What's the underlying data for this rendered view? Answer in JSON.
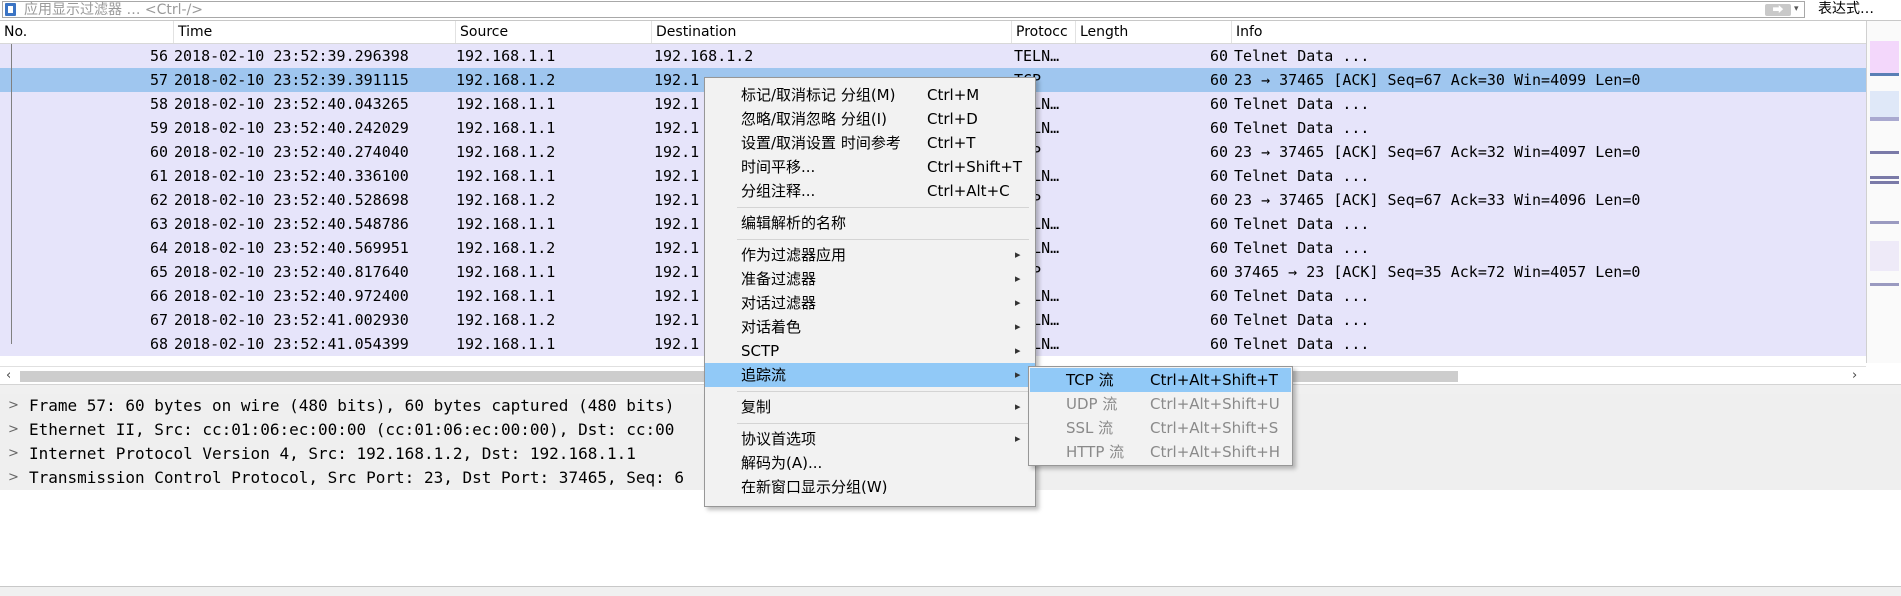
{
  "filter": {
    "placeholder": "应用显示过滤器 … <Ctrl-/>",
    "expression_label": "表达式…"
  },
  "columns": [
    "No.",
    "Time",
    "Source",
    "Destination",
    "Protocc",
    "Length",
    "Info"
  ],
  "packets": [
    {
      "no": "56",
      "time": "2018-02-10 23:52:39.296398",
      "src": "192.168.1.1",
      "dst": "192.168.1.2",
      "proto": "TELN…",
      "len": "60",
      "info": "Telnet Data ..."
    },
    {
      "no": "57",
      "time": "2018-02-10 23:52:39.391115",
      "src": "192.168.1.2",
      "dst": "192.1",
      "proto": "TCP",
      "len": "60",
      "info": "23 → 37465 [ACK] Seq=67 Ack=30 Win=4099 Len=0",
      "selected": true
    },
    {
      "no": "58",
      "time": "2018-02-10 23:52:40.043265",
      "src": "192.168.1.1",
      "dst": "192.1",
      "proto": "TELN…",
      "len": "60",
      "info": "Telnet Data ..."
    },
    {
      "no": "59",
      "time": "2018-02-10 23:52:40.242029",
      "src": "192.168.1.1",
      "dst": "192.1",
      "proto": "TELN…",
      "len": "60",
      "info": "Telnet Data ..."
    },
    {
      "no": "60",
      "time": "2018-02-10 23:52:40.274040",
      "src": "192.168.1.2",
      "dst": "192.1",
      "proto": "TCP",
      "len": "60",
      "info": "23 → 37465 [ACK] Seq=67 Ack=32 Win=4097 Len=0"
    },
    {
      "no": "61",
      "time": "2018-02-10 23:52:40.336100",
      "src": "192.168.1.1",
      "dst": "192.1",
      "proto": "TELN…",
      "len": "60",
      "info": "Telnet Data ..."
    },
    {
      "no": "62",
      "time": "2018-02-10 23:52:40.528698",
      "src": "192.168.1.2",
      "dst": "192.1",
      "proto": "TCP",
      "len": "60",
      "info": "23 → 37465 [ACK] Seq=67 Ack=33 Win=4096 Len=0"
    },
    {
      "no": "63",
      "time": "2018-02-10 23:52:40.548786",
      "src": "192.168.1.1",
      "dst": "192.1",
      "proto": "TELN…",
      "len": "60",
      "info": "Telnet Data ..."
    },
    {
      "no": "64",
      "time": "2018-02-10 23:52:40.569951",
      "src": "192.168.1.2",
      "dst": "192.1",
      "proto": "TELN…",
      "len": "60",
      "info": "Telnet Data ..."
    },
    {
      "no": "65",
      "time": "2018-02-10 23:52:40.817640",
      "src": "192.168.1.1",
      "dst": "192.1",
      "proto": "TCP",
      "len": "60",
      "info": "37465 → 23 [ACK] Seq=35 Ack=72 Win=4057 Len=0"
    },
    {
      "no": "66",
      "time": "2018-02-10 23:52:40.972400",
      "src": "192.168.1.1",
      "dst": "192.1",
      "proto": "TELN…",
      "len": "60",
      "info": "Telnet Data ..."
    },
    {
      "no": "67",
      "time": "2018-02-10 23:52:41.002930",
      "src": "192.168.1.2",
      "dst": "192.1",
      "proto": "TELN…",
      "len": "60",
      "info": "Telnet Data ..."
    },
    {
      "no": "68",
      "time": "2018-02-10 23:52:41.054399",
      "src": "192.168.1.1",
      "dst": "192.1",
      "proto": "TELN…",
      "len": "60",
      "info": "Telnet Data ..."
    }
  ],
  "details": [
    "Frame 57: 60 bytes on wire (480 bits), 60 bytes captured (480 bits)",
    "Ethernet II, Src: cc:01:06:ec:00:00 (cc:01:06:ec:00:00), Dst: cc:00",
    "Internet Protocol Version 4, Src: 192.168.1.2, Dst: 192.168.1.1",
    "Transmission Control Protocol, Src Port: 23, Dst Port: 37465, Seq: 6"
  ],
  "context_menu": {
    "items": [
      {
        "label": "标记/取消标记 分组(M)",
        "shortcut": "Ctrl+M"
      },
      {
        "label": "忽略/取消忽略 分组(I)",
        "shortcut": "Ctrl+D"
      },
      {
        "label": "设置/取消设置 时间参考",
        "shortcut": "Ctrl+T"
      },
      {
        "label": "时间平移...",
        "shortcut": "Ctrl+Shift+T"
      },
      {
        "label": "分组注释...",
        "shortcut": "Ctrl+Alt+C"
      },
      {
        "label": "编辑解析的名称"
      },
      {
        "label": "作为过滤器应用"
      },
      {
        "label": "准备过滤器"
      },
      {
        "label": "对话过滤器"
      },
      {
        "label": "对话着色"
      },
      {
        "label": "SCTP"
      },
      {
        "label": "追踪流"
      },
      {
        "label": "复制"
      },
      {
        "label": "协议首选项"
      },
      {
        "label": "解码为(A)..."
      },
      {
        "label": "在新窗口显示分组(W)"
      }
    ]
  },
  "submenu": {
    "items": [
      {
        "label": "TCP 流",
        "shortcut": "Ctrl+Alt+Shift+T"
      },
      {
        "label": "UDP 流",
        "shortcut": "Ctrl+Alt+Shift+U"
      },
      {
        "label": "SSL 流",
        "shortcut": "Ctrl+Alt+Shift+S"
      },
      {
        "label": "HTTP 流",
        "shortcut": "Ctrl+Alt+Shift+H"
      }
    ]
  },
  "icons": {
    "bookmark": "bookmark-icon",
    "apply": "arrow-right-icon",
    "history": "chevron-down-icon",
    "expand": "chevron-right-icon",
    "submenu": "triangle-right-icon"
  },
  "colors": {
    "row_bg": "#e6e4fa",
    "row_selected": "#9fc6ef",
    "menu_highlight": "#91c9f7"
  }
}
